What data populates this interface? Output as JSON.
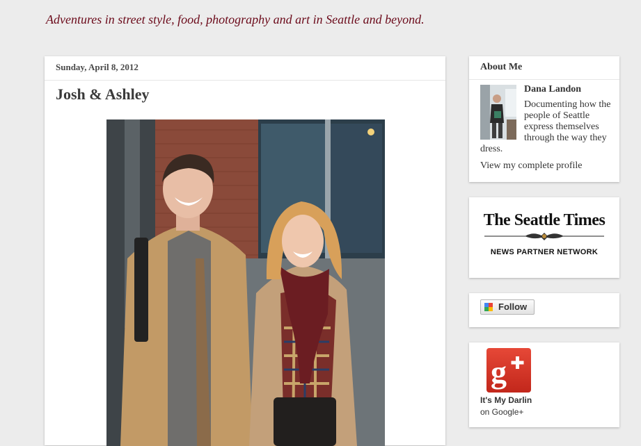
{
  "blog": {
    "tagline": "Adventures in street style, food, photography and art in Seattle and beyond."
  },
  "post": {
    "date": "Sunday, April 8, 2012",
    "title": "Josh & Ashley",
    "photo_icon": "street-style-photo"
  },
  "about": {
    "heading": "About Me",
    "name": "Dana Landon",
    "description": "Documenting how the people of Seattle express themselves through the way they dress.",
    "profile_link": "View my complete profile"
  },
  "seattle_times": {
    "name": "The Seattle Times",
    "subtitle": "NEWS PARTNER NETWORK"
  },
  "follow": {
    "label": "Follow"
  },
  "google_plus": {
    "name": "It's My Darlin",
    "subtitle": "on Google+"
  },
  "colors": {
    "background": "#ececec",
    "tagline": "#6b0a1a",
    "gplus_red": "#d73a2a"
  }
}
